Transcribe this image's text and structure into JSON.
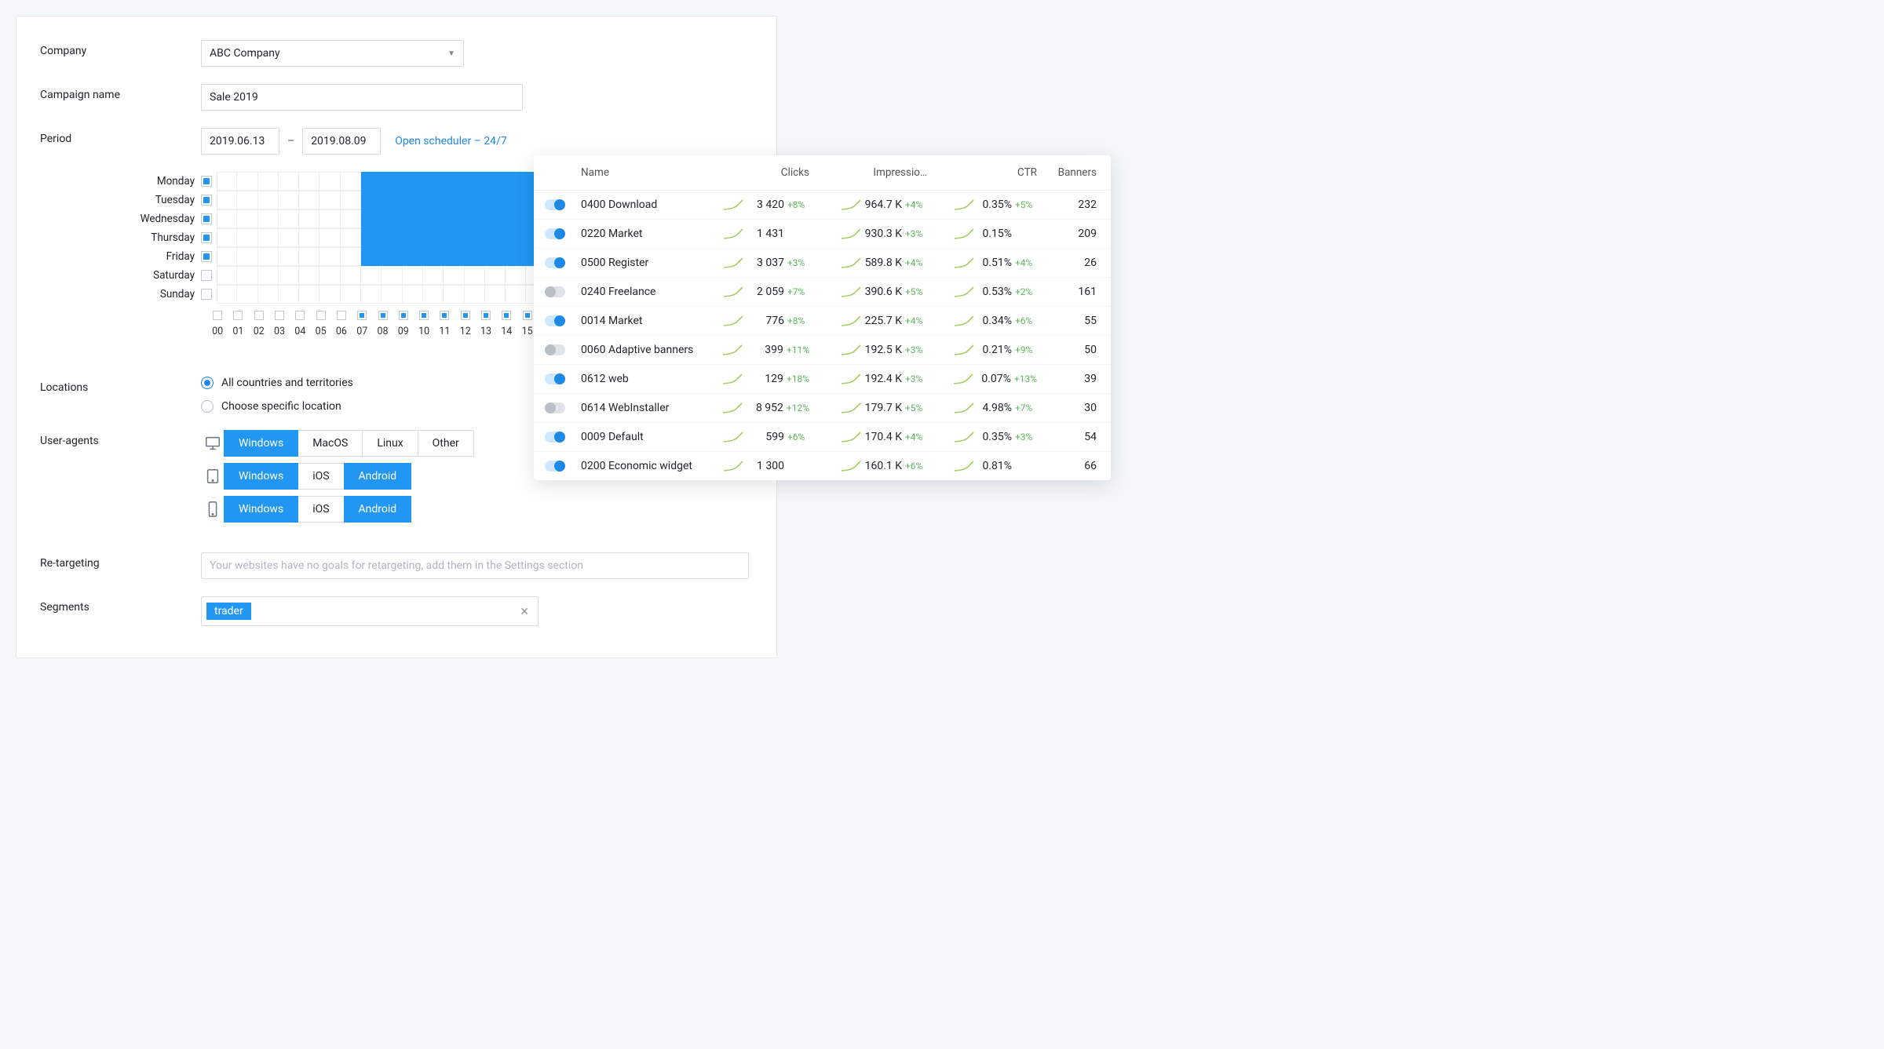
{
  "labels": {
    "company": "Company",
    "campaign": "Campaign name",
    "period": "Period",
    "locations": "Locations",
    "useragents": "User-agents",
    "retarget": "Re-targeting",
    "segments": "Segments"
  },
  "company_value": "ABC Company",
  "campaign_value": "Sale 2019",
  "period_from": "2019.06.13",
  "period_dash": "–",
  "period_to": "2019.08.09",
  "scheduler_link": "Open scheduler – 24/7",
  "scheduler": {
    "days": [
      {
        "name": "Monday",
        "checked": true
      },
      {
        "name": "Tuesday",
        "checked": true
      },
      {
        "name": "Wednesday",
        "checked": true
      },
      {
        "name": "Thursday",
        "checked": true
      },
      {
        "name": "Friday",
        "checked": true
      },
      {
        "name": "Saturday",
        "checked": false
      },
      {
        "name": "Sunday",
        "checked": false
      }
    ],
    "hours": [
      "00",
      "01",
      "02",
      "03",
      "04",
      "05",
      "06",
      "07",
      "08",
      "09",
      "10",
      "11",
      "12",
      "13",
      "14",
      "15"
    ],
    "fill_from_hour": 7,
    "fill_days": 5,
    "visible_cols": 24
  },
  "locations": {
    "opt_all": "All countries and territories",
    "opt_specific": "Choose specific location",
    "selected": "all"
  },
  "ua": {
    "desktop": [
      {
        "label": "Windows",
        "sel": true
      },
      {
        "label": "MacOS",
        "sel": false
      },
      {
        "label": "Linux",
        "sel": false
      },
      {
        "label": "Other",
        "sel": false
      }
    ],
    "tablet": [
      {
        "label": "Windows",
        "sel": true
      },
      {
        "label": "iOS",
        "sel": false
      },
      {
        "label": "Android",
        "sel": true
      }
    ],
    "mobile": [
      {
        "label": "Windows",
        "sel": true
      },
      {
        "label": "iOS",
        "sel": false
      },
      {
        "label": "Android",
        "sel": true
      }
    ]
  },
  "retarget_placeholder": "Your websites have no goals for retargeting, add them in the Settings section",
  "segments_tag": "trader",
  "stats": {
    "headers": {
      "name": "Name",
      "clicks": "Clicks",
      "impr": "Impressio…",
      "ctr": "CTR",
      "banners": "Banners"
    },
    "rows": [
      {
        "on": true,
        "name": "0400 Download",
        "clicks": "3 420",
        "clicks_d": "+8%",
        "impr": "964.7 K",
        "impr_d": "+4%",
        "ctr": "0.35%",
        "ctr_d": "+5%",
        "banners": "232"
      },
      {
        "on": true,
        "name": "0220 Market",
        "clicks": "1 431",
        "clicks_d": "",
        "impr": "930.3 K",
        "impr_d": "+3%",
        "ctr": "0.15%",
        "ctr_d": "",
        "banners": "209"
      },
      {
        "on": true,
        "name": "0500 Register",
        "clicks": "3 037",
        "clicks_d": "+3%",
        "impr": "589.8 K",
        "impr_d": "+4%",
        "ctr": "0.51%",
        "ctr_d": "+4%",
        "banners": "26"
      },
      {
        "on": false,
        "name": "0240 Freelance",
        "clicks": "2 059",
        "clicks_d": "+7%",
        "impr": "390.6 K",
        "impr_d": "+5%",
        "ctr": "0.53%",
        "ctr_d": "+2%",
        "banners": "161"
      },
      {
        "on": true,
        "name": "0014 Market",
        "clicks": "776",
        "clicks_d": "+8%",
        "impr": "225.7 K",
        "impr_d": "+4%",
        "ctr": "0.34%",
        "ctr_d": "+6%",
        "banners": "55"
      },
      {
        "on": false,
        "name": "0060 Adaptive banners",
        "clicks": "399",
        "clicks_d": "+11%",
        "impr": "192.5 K",
        "impr_d": "+3%",
        "ctr": "0.21%",
        "ctr_d": "+9%",
        "banners": "50"
      },
      {
        "on": true,
        "name": "0612 web",
        "clicks": "129",
        "clicks_d": "+18%",
        "impr": "192.4 K",
        "impr_d": "+3%",
        "ctr": "0.07%",
        "ctr_d": "+13%",
        "banners": "39"
      },
      {
        "on": false,
        "name": "0614 WebInstaller",
        "clicks": "8 952",
        "clicks_d": "+12%",
        "impr": "179.7 K",
        "impr_d": "+5%",
        "ctr": "4.98%",
        "ctr_d": "+7%",
        "banners": "30"
      },
      {
        "on": true,
        "name": "0009 Default",
        "clicks": "599",
        "clicks_d": "+6%",
        "impr": "170.4 K",
        "impr_d": "+4%",
        "ctr": "0.35%",
        "ctr_d": "+3%",
        "banners": "54"
      },
      {
        "on": true,
        "name": "0200 Economic widget",
        "clicks": "1 300",
        "clicks_d": "",
        "impr": "160.1 K",
        "impr_d": "+6%",
        "ctr": "0.81%",
        "ctr_d": "",
        "banners": "66"
      }
    ]
  }
}
